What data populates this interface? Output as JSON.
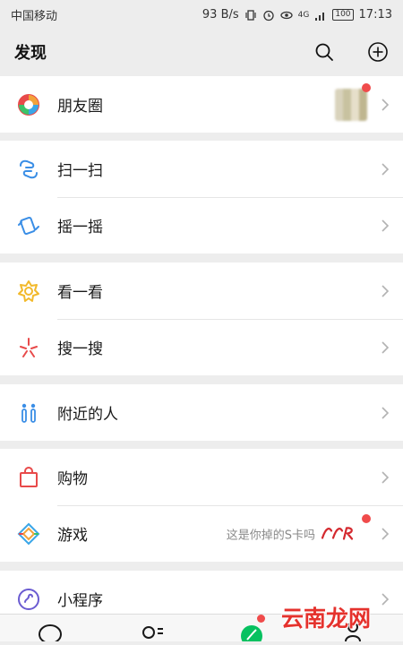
{
  "status_bar": {
    "carrier": "中国移动",
    "speed": "93 B/s",
    "network": "4G",
    "battery": "100",
    "time": "17:13"
  },
  "header": {
    "title": "发现",
    "search_icon": "search-icon",
    "add_icon": "plus-circle-icon"
  },
  "rows": {
    "moments": "朋友圈",
    "scan": "扫一扫",
    "shake": "摇一摇",
    "top_stories": "看一看",
    "search": "搜一搜",
    "people_nearby": "附近的人",
    "shopping": "购物",
    "games": "游戏",
    "games_hint": "这是你掉的S卡吗",
    "mini_programs": "小程序"
  },
  "watermark": "云南龙网",
  "colors": {
    "background": "#ededed",
    "accent_green": "#07c160",
    "badge_red": "#f04b4b"
  }
}
